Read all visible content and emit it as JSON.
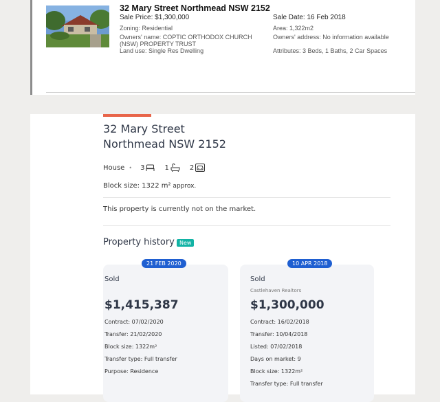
{
  "record": {
    "title": "32 Mary Street Northmead NSW 2152",
    "sale_price": "Sale Price: $1,300,000",
    "sale_date": "Sale Date: 16 Feb 2018",
    "zoning": "Zoning: Residential",
    "area": "Area: 1,322m2",
    "owners_name_1": "Owners' name: COPTIC ORTHODOX CHURCH",
    "owners_name_2": "(NSW) PROPERTY TRUST",
    "owners_address": "Owners' address: No information available",
    "land_use": "Land use: Single Res Dwelling",
    "attributes": "Attributes: 3 Beds, 1 Baths, 2 Car Spaces"
  },
  "property": {
    "address_line1": "32 Mary Street",
    "address_line2": "Northmead NSW 2152",
    "type": "House",
    "beds": "3",
    "baths": "1",
    "cars": "2",
    "block_label": "Block size: ",
    "block_value": "1322 m²",
    "block_approx": " approx.",
    "market_status": "This property is currently not on the market."
  },
  "history": {
    "title": "Property history",
    "badge": "New",
    "cards": [
      {
        "date": "21 FEB 2020",
        "status": "Sold",
        "agency": "",
        "price": "$1,415,387",
        "lines": [
          "Contract: 07/02/2020",
          "Transfer: 21/02/2020",
          "Block size: 1322m²",
          "Transfer type: Full transfer",
          "Purpose: Residence"
        ]
      },
      {
        "date": "10 APR 2018",
        "status": "Sold",
        "agency": "Castlehaven Realtors",
        "price": "$1,300,000",
        "lines": [
          "Contract: 16/02/2018",
          "Transfer: 10/04/2018",
          "Listed: 07/02/2018",
          "Days on market: 9",
          "Block size: 1322m²",
          "Transfer type: Full transfer"
        ]
      }
    ]
  },
  "colors": {
    "accent": "#e8654a",
    "pill": "#1f5fd1",
    "new_badge": "#12b3a5",
    "card_bg": "#f3f4f7",
    "page_bg": "#efeeec"
  }
}
